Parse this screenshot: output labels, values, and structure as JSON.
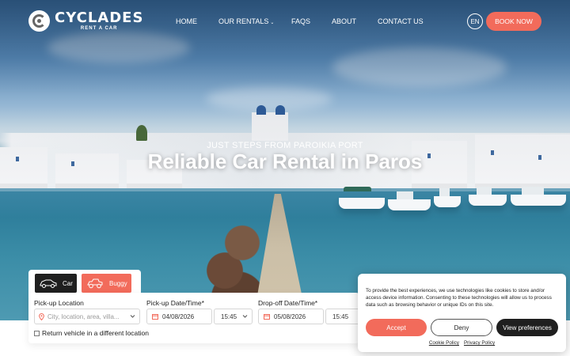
{
  "brand": {
    "name": "CYCLADES",
    "tagline": "RENT A CAR"
  },
  "nav": {
    "items": [
      {
        "label": "HOME"
      },
      {
        "label": "OUR RENTALS"
      },
      {
        "label": "FAQS"
      },
      {
        "label": "ABOUT"
      },
      {
        "label": "CONTACT US"
      }
    ],
    "language": "EN",
    "book_now": "BOOK NOW"
  },
  "hero": {
    "kicker": "JUST STEPS FROM PAROIKIA PORT",
    "title": "Reliable Car Rental in Paros"
  },
  "booking": {
    "tabs": [
      {
        "label": "Car",
        "icon": "car-icon"
      },
      {
        "label": "Buggy",
        "icon": "buggy-icon"
      }
    ],
    "pickup_location": {
      "label": "Pick-up Location",
      "placeholder": "City, location, area, villa..."
    },
    "pickup_datetime": {
      "label": "Pick-up Date/Time*",
      "date": "04/08/2026",
      "time": "15:45"
    },
    "dropoff_datetime": {
      "label": "Drop-off Date/Time*",
      "date": "05/08/2026",
      "time": "15:45"
    },
    "return_different": {
      "label": "Return vehicle in a different location",
      "checked": false
    }
  },
  "cookie": {
    "text": "To provide the best experiences, we use technologies like cookies to store and/or access device information. Consenting to these technologies will allow us to process data such as browsing behavior or unique IDs on this site.",
    "accept": "Accept",
    "deny": "Deny",
    "preferences": "View preferences",
    "cookie_policy": "Cookie Policy",
    "privacy_policy": "Privacy Policy"
  },
  "colors": {
    "accent": "#f26b5b",
    "dark": "#1f1f1f"
  }
}
